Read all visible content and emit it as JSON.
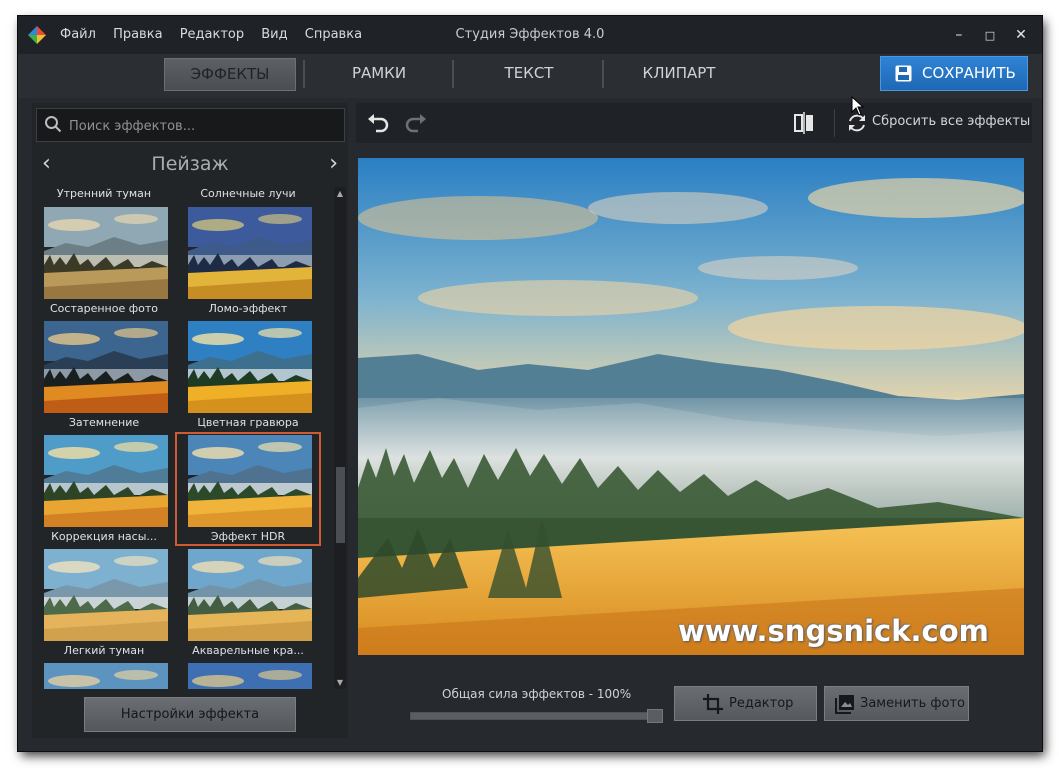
{
  "window": {
    "title": "Студия Эффектов 4.0",
    "menu": [
      "Файл",
      "Правка",
      "Редактор",
      "Вид",
      "Справка"
    ],
    "controls": {
      "minimize": "–",
      "maximize": "□",
      "close": "✕"
    }
  },
  "tabs": [
    {
      "label": "ЭФФЕКТЫ",
      "active": true
    },
    {
      "label": "РАМКИ",
      "active": false
    },
    {
      "label": "ТЕКСТ",
      "active": false
    },
    {
      "label": "КЛИПАРТ",
      "active": false
    }
  ],
  "save_button": {
    "label": "СОХРАНИТЬ",
    "color": "#1f6fc3"
  },
  "effects_panel": {
    "search_placeholder": "Поиск эффектов...",
    "category": {
      "prev": "‹",
      "title": "Пейзаж",
      "next": "›"
    },
    "partial_top_labels": [
      "Утренний туман",
      "Солнечные лучи"
    ],
    "tiles": [
      {
        "label": "Состаренное фото"
      },
      {
        "label": "Ломо-эффект"
      },
      {
        "label": "Затемнение"
      },
      {
        "label": "Цветная гравюра"
      },
      {
        "label": "Коррекция насы..."
      },
      {
        "label": "Эффект HDR",
        "selected": true
      },
      {
        "label": "Легкий туман"
      },
      {
        "label": "Акварельные кра..."
      }
    ],
    "settings_button": "Настройки эффекта"
  },
  "toolbar": {
    "reset_label": "Сбросить все эффекты",
    "icons": [
      "undo-icon",
      "redo-icon",
      "compare-icon",
      "reset-icon"
    ]
  },
  "preview": {
    "watermark": "www.sngsnick.com"
  },
  "bottom": {
    "strength_label": "Общая сила эффектов - 100%",
    "strength_value": 1.0,
    "editor_button": "Редактор",
    "replace_button": "Заменить фото"
  },
  "colors": {
    "accent": "#1f6fc3",
    "selection": "#d05a34",
    "window_bg": "#26292d"
  }
}
